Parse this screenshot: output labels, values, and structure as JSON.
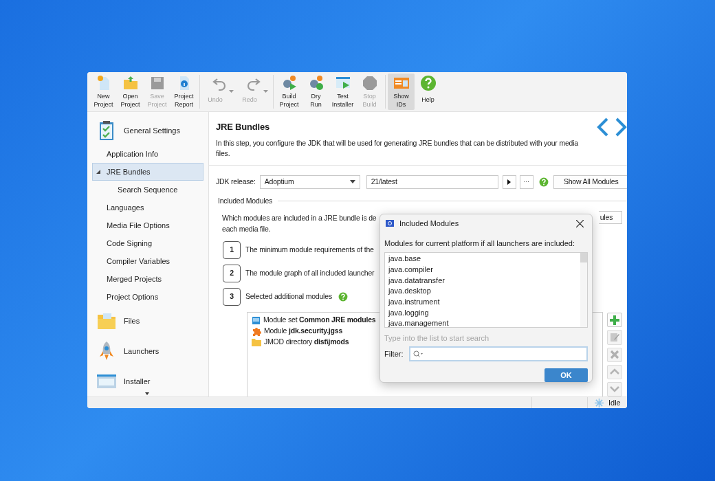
{
  "toolbar": [
    {
      "buttons": [
        {
          "label": "New\nProject",
          "disabled": false,
          "selected": false
        },
        {
          "label": "Open\nProject",
          "disabled": false,
          "selected": false
        },
        {
          "label": "Save\nProject",
          "disabled": true,
          "selected": false
        },
        {
          "label": "Project\nReport",
          "disabled": false,
          "selected": false
        }
      ]
    },
    {
      "buttons": [
        {
          "label": "Undo",
          "disabled": true,
          "selected": false,
          "dropdown": true
        },
        {
          "label": "Redo",
          "disabled": true,
          "selected": false,
          "dropdown": true
        }
      ]
    },
    {
      "buttons": [
        {
          "label": "Build\nProject",
          "disabled": false,
          "selected": false
        },
        {
          "label": "Dry\nRun",
          "disabled": false,
          "selected": false
        },
        {
          "label": "Test\nInstaller",
          "disabled": false,
          "selected": false
        },
        {
          "label": "Stop\nBuild",
          "disabled": true,
          "selected": false
        }
      ]
    },
    {
      "buttons": [
        {
          "label": "Show\nIDs",
          "disabled": false,
          "selected": true
        },
        {
          "label": "Help",
          "disabled": false,
          "selected": false
        }
      ]
    }
  ],
  "sidebar": {
    "sections": [
      {
        "label": "General Settings",
        "children": [
          {
            "label": "Application Info",
            "selected": false
          },
          {
            "label": "JRE Bundles",
            "selected": true,
            "expanded": true,
            "children": [
              {
                "label": "Search Sequence",
                "selected": false
              }
            ]
          },
          {
            "label": "Languages",
            "selected": false
          },
          {
            "label": "Media File Options",
            "selected": false
          },
          {
            "label": "Code Signing",
            "selected": false
          },
          {
            "label": "Compiler Variables",
            "selected": false
          },
          {
            "label": "Merged Projects",
            "selected": false
          },
          {
            "label": "Project Options",
            "selected": false
          }
        ]
      },
      {
        "label": "Files"
      },
      {
        "label": "Launchers"
      },
      {
        "label": "Installer"
      }
    ]
  },
  "page": {
    "title": "JRE Bundles",
    "description": "In this step, you configure the JDK that will be used for generating JRE bundles that can be distributed with your media files.",
    "jdk_label": "JDK release:",
    "jdk_vendor": "Adoptium",
    "jdk_version": "21/latest",
    "more_button": "···",
    "show_all_button": "Show All Modules",
    "section_title": "Included Modules",
    "intro_lines": [
      "Which modules are included in a JRE bundle is de",
      "each media file."
    ],
    "intro_button": "ules",
    "steps": [
      {
        "number": "1",
        "text": "The minimum module requirements of the"
      },
      {
        "number": "2",
        "text": "The module graph of all included launcher"
      },
      {
        "number": "3",
        "text": "Selected additional modules",
        "help": true
      }
    ],
    "modules": [
      {
        "kind": "module_set",
        "text": "Module set **Common JRE modules**"
      },
      {
        "kind": "module",
        "text": "Module **jdk.security.jgss**"
      },
      {
        "kind": "jmod_dir",
        "text": "JMOD directory **dist\\jmods**"
      }
    ],
    "side_buttons": [
      {
        "kind": "add",
        "disabled": false
      },
      {
        "kind": "edit",
        "disabled": true
      },
      {
        "kind": "delete",
        "disabled": true
      },
      {
        "kind": "up",
        "disabled": true
      },
      {
        "kind": "down",
        "disabled": true
      }
    ]
  },
  "status_bar": {
    "text": "Idle"
  },
  "dialog": {
    "title": "Included Modules",
    "label": "Modules for current platform if all launchers are included:",
    "items": [
      "java.base",
      "java.compiler",
      "java.datatransfer",
      "java.desktop",
      "java.instrument",
      "java.logging",
      "java.management"
    ],
    "hint": "Type into the list to start search",
    "filter_label": "Filter:",
    "ok_button": "OK"
  }
}
